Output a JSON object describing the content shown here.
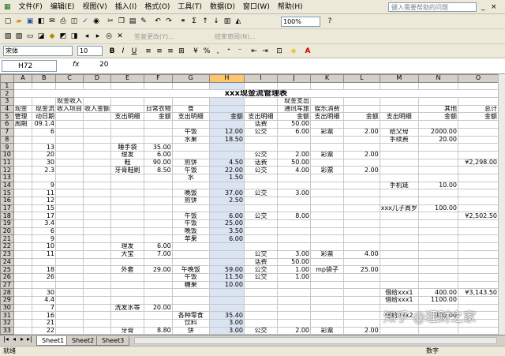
{
  "menubar": {
    "items": [
      "文件(F)",
      "编辑(E)",
      "视图(V)",
      "插入(I)",
      "格式(O)",
      "工具(T)",
      "数据(D)",
      "窗口(W)",
      "帮助(H)"
    ],
    "help_placeholder": "键入需要帮助的问题"
  },
  "toolbar1": {
    "zoom": "100%"
  },
  "toolbar2": {
    "reply_label": "答复更改(Y)...",
    "end_review_label": "结束审阅(N)..."
  },
  "format_toolbar": {
    "font_name": "宋体",
    "font_size": "10",
    "bold": "B",
    "italic": "I",
    "underline": "U"
  },
  "formula_bar": {
    "cell_ref": "H72",
    "fx": "fx",
    "value": "20"
  },
  "grid": {
    "columns": [
      "A",
      "B",
      "C",
      "D",
      "E",
      "F",
      "G",
      "H",
      "I",
      "J",
      "K",
      "L",
      "M",
      "N",
      "O"
    ],
    "rows": [
      {
        "n": "1",
        "c": {}
      },
      {
        "n": "2",
        "c": {
          "title": "xxx现金流管理表"
        }
      },
      {
        "n": "3",
        "c": {
          "C": "现金收入",
          "J": "现金支出"
        }
      },
      {
        "n": "4",
        "c": {
          "A": "现金",
          "B": "现金流",
          "C": "收入项目",
          "D": "收入金额",
          "F": "日常衣物",
          "G": "食",
          "J": "通讯车旅",
          "K": "娱乐消费",
          "N": "其他",
          "O": "总计"
        }
      },
      {
        "n": "5",
        "c": {
          "A": "管理",
          "B": "动日期",
          "E": "支出明细",
          "F": "金额",
          "G": "支出明细",
          "H": "金额",
          "I": "支出明细",
          "J": "金额",
          "K": "支出明细",
          "L": "金额",
          "M": "支出明细",
          "N": "金额",
          "O": "金额"
        }
      },
      {
        "n": "6",
        "c": {
          "A": "周期",
          "B": "09.1.4",
          "I": "话费",
          "J": "50.00"
        }
      },
      {
        "n": "7",
        "c": {
          "B": "6",
          "G": "午饭",
          "H": "12.00",
          "I": "公交",
          "J": "6.00",
          "K": "彩票",
          "L": "2.00",
          "M": "给父母",
          "N": "2000.00"
        }
      },
      {
        "n": "8",
        "c": {
          "G": "水果",
          "H": "18.50",
          "M": "手续费",
          "N": "20.00"
        }
      },
      {
        "n": "9",
        "c": {
          "B": "13",
          "E": "睡手袋",
          "F": "35.00"
        }
      },
      {
        "n": "10",
        "c": {
          "B": "20",
          "E": "理发",
          "F": "6.00",
          "I": "公交",
          "J": "2.00",
          "K": "彩票",
          "L": "2.00"
        }
      },
      {
        "n": "11",
        "c": {
          "B": "30",
          "E": "鞋",
          "F": "90.00",
          "G": "煎饼",
          "H": "4.50",
          "I": "话费",
          "J": "50.00",
          "O": "¥2,298.00"
        }
      },
      {
        "n": "12",
        "c": {
          "B": "2.3",
          "E": "牙膏鞋刷",
          "F": "8.50",
          "G": "午饭",
          "H": "22.00",
          "I": "公交",
          "J": "4.00",
          "K": "彩票",
          "L": "2.00"
        }
      },
      {
        "n": "13",
        "c": {
          "G": "水",
          "H": "1.50"
        }
      },
      {
        "n": "14",
        "c": {
          "B": "9",
          "M": "手机链",
          "N": "10.00"
        }
      },
      {
        "n": "15",
        "c": {
          "B": "11",
          "G": "晚饭",
          "H": "37.00",
          "I": "公交",
          "J": "3.00"
        }
      },
      {
        "n": "16",
        "c": {
          "B": "12",
          "G": "煎饼",
          "H": "2.50"
        }
      },
      {
        "n": "17",
        "c": {
          "B": "15",
          "M": "xxx儿子周岁",
          "N": "100.00"
        }
      },
      {
        "n": "18",
        "c": {
          "B": "17",
          "G": "午饭",
          "H": "6.00",
          "I": "公交",
          "J": "8.00",
          "O": "¥2,502.50"
        }
      },
      {
        "n": "19",
        "c": {
          "B": "3.4",
          "G": "午饭",
          "H": "25.00"
        }
      },
      {
        "n": "20",
        "c": {
          "B": "6",
          "G": "晚饭",
          "H": "3.50"
        }
      },
      {
        "n": "21",
        "c": {
          "B": "9",
          "G": "苹果",
          "H": "6.00"
        }
      },
      {
        "n": "22",
        "c": {
          "B": "10",
          "E": "理发",
          "F": "6.00"
        }
      },
      {
        "n": "23",
        "c": {
          "B": "11",
          "E": "大宝",
          "F": "7.00",
          "I": "公交",
          "J": "3.00",
          "K": "彩票",
          "L": "4.00"
        }
      },
      {
        "n": "24",
        "c": {
          "I": "话费",
          "J": "50.00"
        }
      },
      {
        "n": "25",
        "c": {
          "B": "18",
          "E": "外套",
          "F": "29.00",
          "G": "午晚饭",
          "H": "59.00",
          "I": "公交",
          "J": "1.00",
          "K": "mp袋子",
          "L": "25.00"
        }
      },
      {
        "n": "26",
        "c": {
          "B": "26",
          "G": "午饭",
          "H": "11.50",
          "I": "公交",
          "J": "1.00"
        }
      },
      {
        "n": "27",
        "c": {
          "G": "糖果",
          "H": "10.00"
        }
      },
      {
        "n": "28",
        "c": {
          "B": "30",
          "M": "借给xxx1",
          "N": "400.00",
          "O": "¥3,143.50"
        }
      },
      {
        "n": "29",
        "c": {
          "B": "4.4",
          "M": "借给xxx1",
          "N": "1100.00"
        }
      },
      {
        "n": "30",
        "c": {
          "B": "7",
          "E": "洗发水等",
          "F": "20.00"
        }
      },
      {
        "n": "31",
        "c": {
          "B": "16",
          "G": "各种零食",
          "H": "35.40",
          "M": "借给xxx2",
          "N": "800.00"
        }
      },
      {
        "n": "32",
        "c": {
          "B": "21",
          "G": "饮料",
          "H": "3.00"
        }
      },
      {
        "n": "33",
        "c": {
          "B": "22",
          "E": "牙膏",
          "F": "8.80",
          "G": "饼",
          "H": "3.00",
          "I": "公交",
          "J": "2.00",
          "K": "彩票",
          "L": "2.00"
        }
      }
    ]
  },
  "sheet_tabs": [
    "Sheet1",
    "Sheet2",
    "Sheet3"
  ],
  "status": {
    "left": "就绪",
    "right": "数字"
  },
  "watermark": "知乎 @理财之家",
  "colors": {
    "selected_column": "#ffc56b",
    "toolbar_bg": "#ece9d8"
  }
}
